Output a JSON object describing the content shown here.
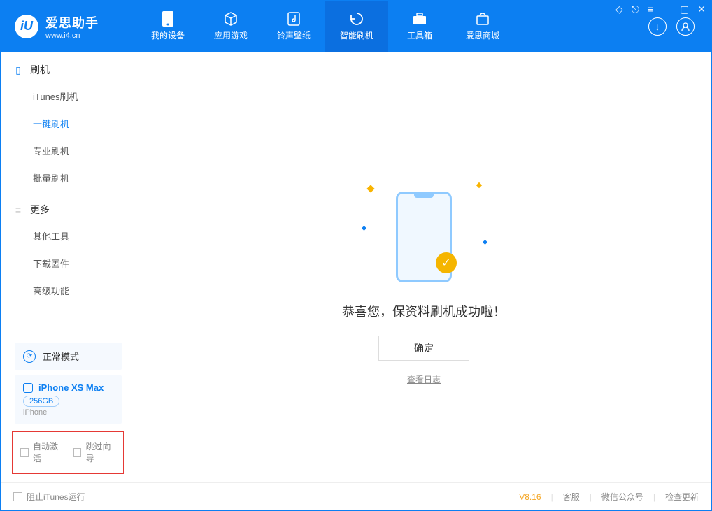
{
  "app": {
    "name_cn": "爱思助手",
    "url": "www.i4.cn"
  },
  "window": {
    "settings_icon": "⚙",
    "skin_icon": "◇",
    "list_icon": "≡",
    "min_icon": "—",
    "max_icon": "▢",
    "close_icon": "✕"
  },
  "header": {
    "tabs": [
      {
        "label": "我的设备"
      },
      {
        "label": "应用游戏"
      },
      {
        "label": "铃声壁纸"
      },
      {
        "label": "智能刷机"
      },
      {
        "label": "工具箱"
      },
      {
        "label": "爱思商城"
      }
    ],
    "active_tab_index": 3,
    "download_icon": "↓",
    "user_icon": "👤"
  },
  "sidebar": {
    "group1": {
      "title": "刷机",
      "items": [
        {
          "label": "iTunes刷机"
        },
        {
          "label": "一键刷机"
        },
        {
          "label": "专业刷机"
        },
        {
          "label": "批量刷机"
        }
      ],
      "active_index": 1
    },
    "group2": {
      "title": "更多",
      "items": [
        {
          "label": "其他工具"
        },
        {
          "label": "下载固件"
        },
        {
          "label": "高级功能"
        }
      ]
    },
    "mode": {
      "label": "正常模式",
      "icon": "⟳"
    },
    "device": {
      "name": "iPhone XS Max",
      "storage": "256GB",
      "type": "iPhone"
    },
    "options": {
      "auto_activate": "自动激活",
      "skip_guide": "跳过向导"
    }
  },
  "content": {
    "success_msg": "恭喜您，保资料刷机成功啦！",
    "ok_label": "确定",
    "log_link": "查看日志",
    "check_icon": "✓"
  },
  "footer": {
    "block_itunes": "阻止iTunes运行",
    "version": "V8.16",
    "customer_service": "客服",
    "wechat": "微信公众号",
    "check_update": "检查更新"
  }
}
